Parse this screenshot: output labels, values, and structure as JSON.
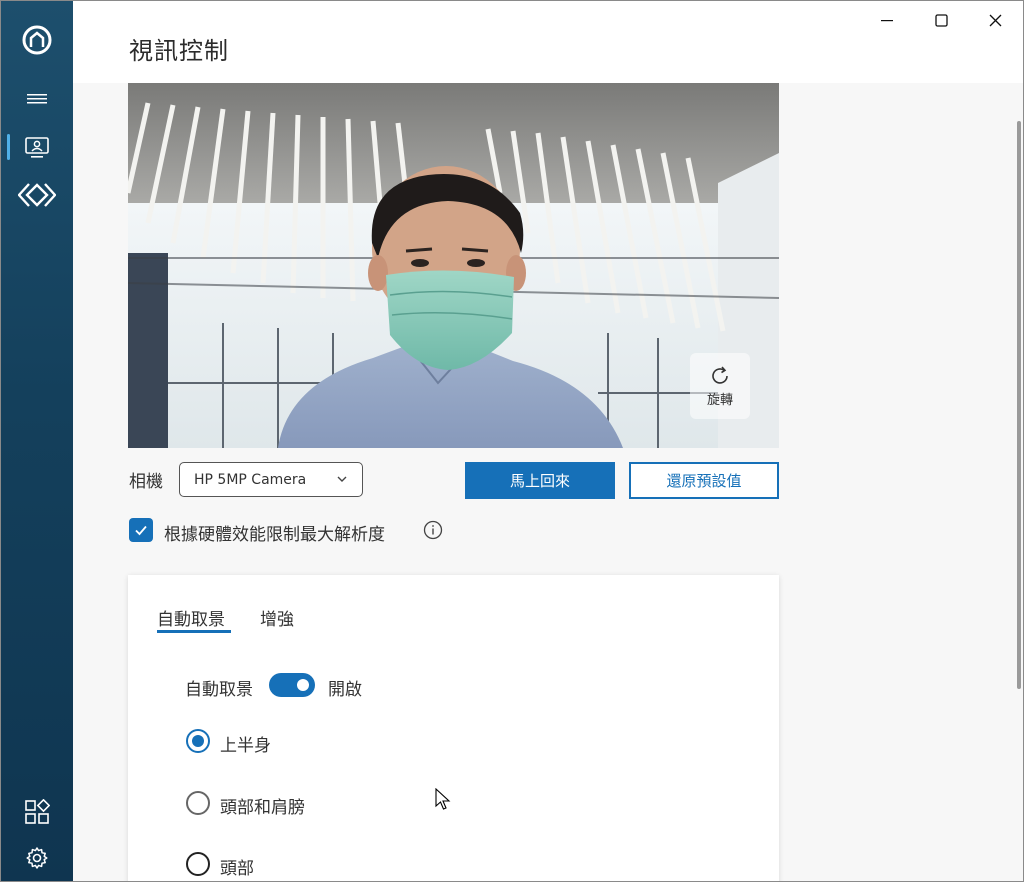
{
  "window": {
    "title": "視訊控制"
  },
  "sidebar": {
    "items": [
      {
        "name": "hp-logo-icon"
      },
      {
        "name": "hamburger-menu-icon"
      },
      {
        "name": "video-control-icon",
        "active": true
      },
      {
        "name": "diamond-arrows-icon"
      },
      {
        "name": "apps-icon"
      },
      {
        "name": "settings-gear-icon"
      }
    ]
  },
  "preview": {
    "rotate_label": "旋轉"
  },
  "camera": {
    "label": "相機",
    "selected": "HP 5MP Camera"
  },
  "buttons": {
    "primary": "馬上回來",
    "restore_defaults": "還原預設值"
  },
  "limit_resolution": {
    "checked": true,
    "label": "根據硬體效能限制最大解析度"
  },
  "card": {
    "tabs": [
      {
        "label": "自動取景",
        "active": true
      },
      {
        "label": "增強",
        "active": false
      }
    ],
    "auto_frame": {
      "label": "自動取景",
      "state_label": "開啟",
      "enabled": true
    },
    "options": [
      {
        "label": "上半身",
        "checked": true
      },
      {
        "label": "頭部和肩膀",
        "checked": false
      },
      {
        "label": "頭部",
        "checked": false
      }
    ]
  },
  "colors": {
    "accent": "#1670b8",
    "sidebar": "#14405c",
    "background": "#f7f7f7"
  }
}
